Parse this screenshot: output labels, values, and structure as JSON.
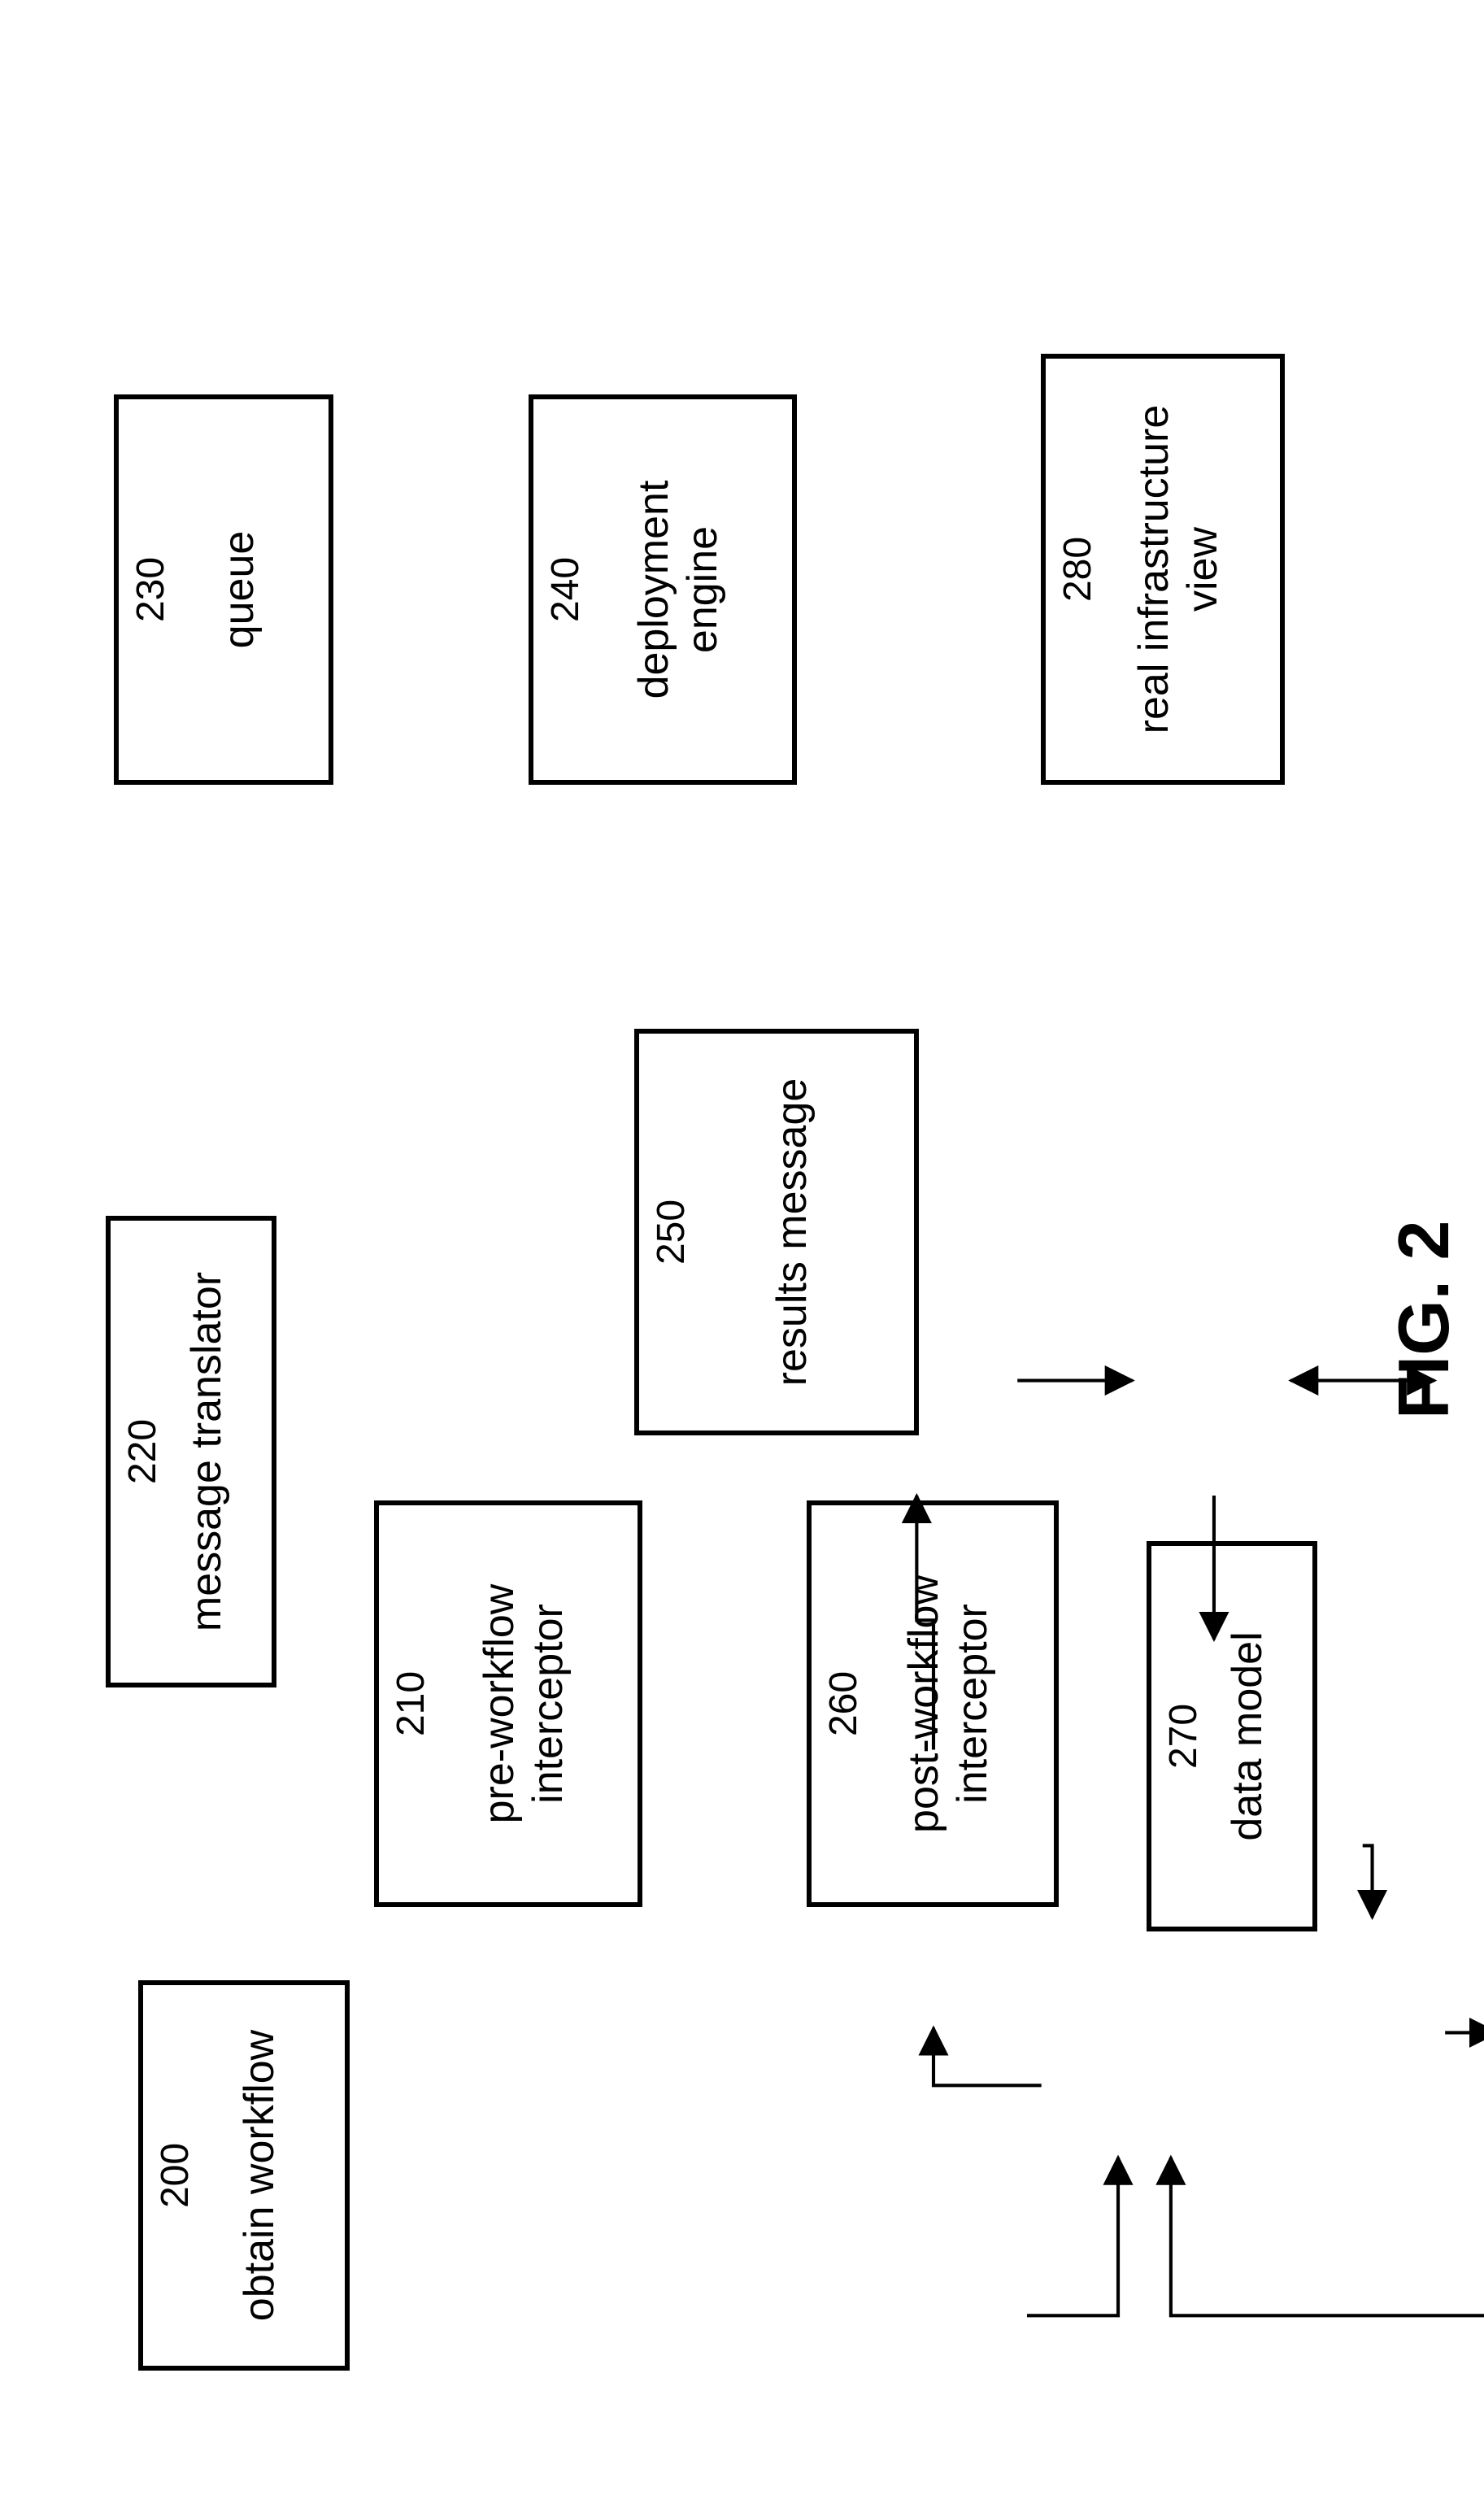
{
  "figure_caption": "FIG. 2",
  "nodes": {
    "obtain_workflow": {
      "num": "200",
      "label": "obtain  workflow"
    },
    "pre_workflow": {
      "num": "210",
      "label": "pre-workflow\ninterceptor"
    },
    "message_translator": {
      "num": "220",
      "label": "message translator"
    },
    "queue": {
      "num": "230",
      "label": "queue"
    },
    "deployment_engine": {
      "num": "240",
      "label": "deployment\nengine"
    },
    "results_message": {
      "num": "250",
      "label": "results message"
    },
    "post_workflow": {
      "num": "260",
      "label": "post-workflow\ninterceptor"
    },
    "data_model": {
      "num": "270",
      "label": "data model"
    },
    "real_infra": {
      "num": "280",
      "label": "real infrastructure\nview"
    }
  }
}
